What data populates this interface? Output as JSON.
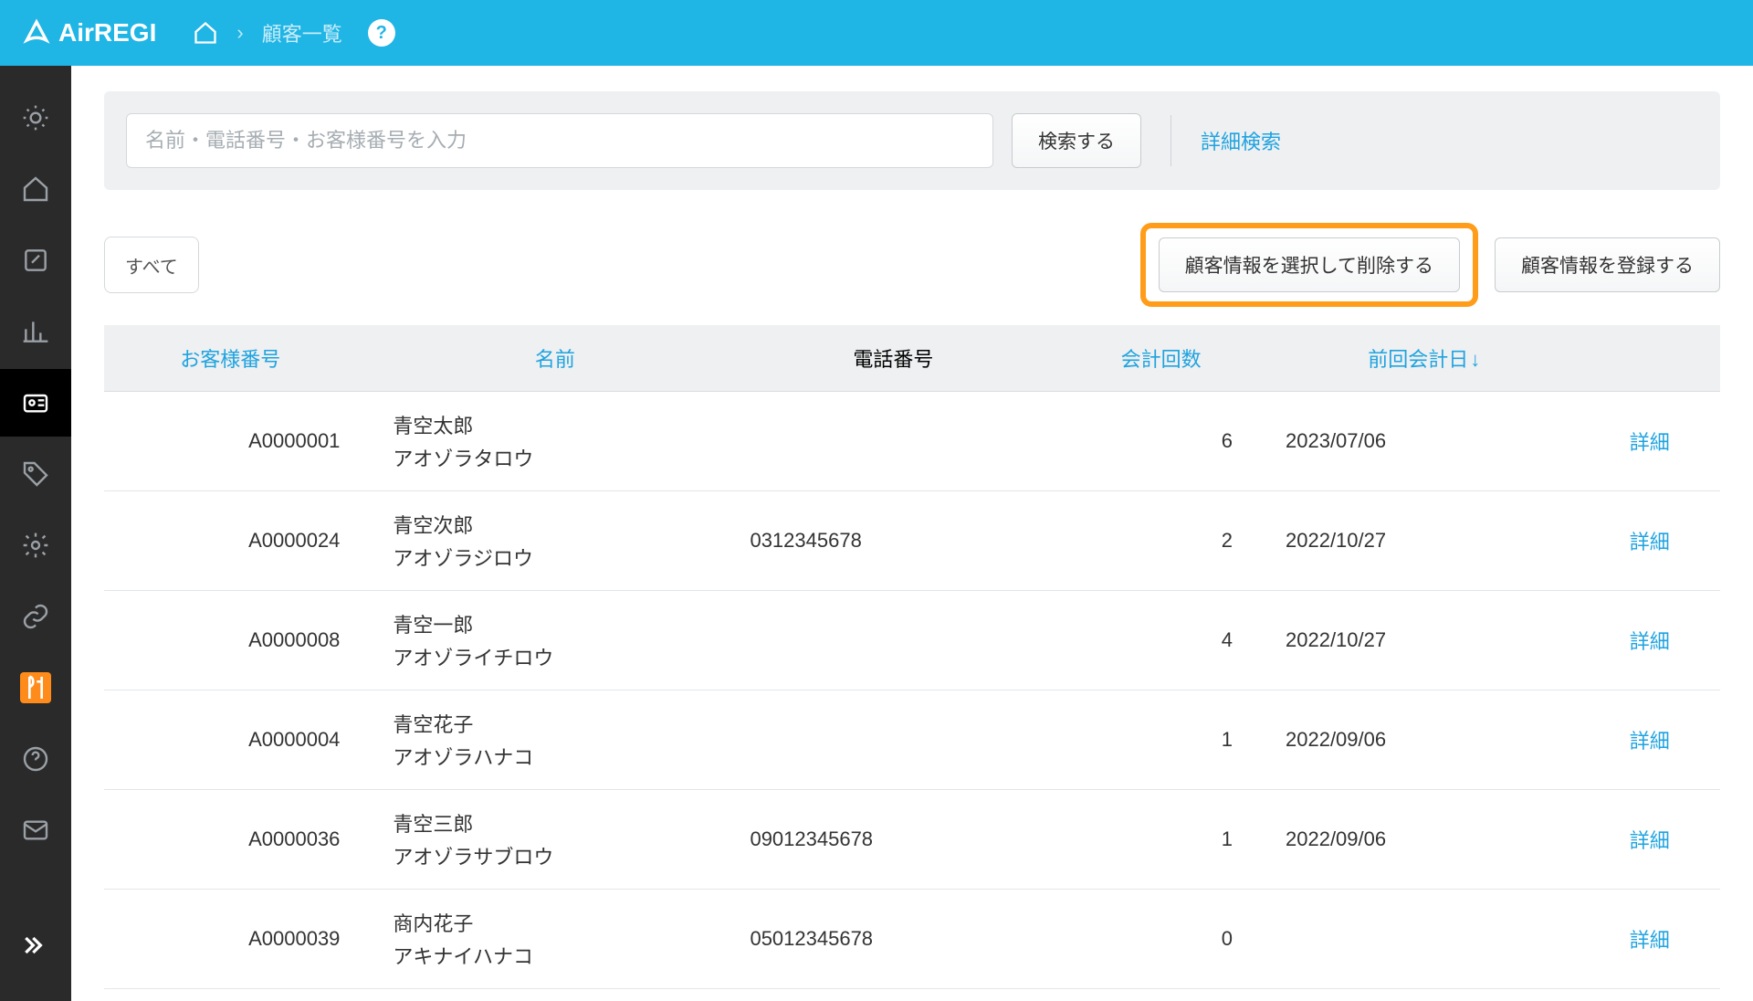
{
  "app": {
    "name": "AirREGI"
  },
  "breadcrumb": {
    "current": "顧客一覧",
    "help": "?"
  },
  "search": {
    "placeholder": "名前・電話番号・お客様番号を入力",
    "button": "検索する",
    "advanced": "詳細検索"
  },
  "toolbar": {
    "filter_all": "すべて",
    "delete_selected": "顧客情報を選択して削除する",
    "register": "顧客情報を登録する"
  },
  "table": {
    "headers": {
      "customer_no": "お客様番号",
      "name": "名前",
      "phone": "電話番号",
      "count": "会計回数",
      "last_date": "前回会計日",
      "sort_arrow": "↓"
    },
    "detail_label": "詳細",
    "rows": [
      {
        "customer_no": "A0000001",
        "name": "青空太郎",
        "kana": "アオゾラタロウ",
        "phone": "",
        "count": "6",
        "last_date": "2023/07/06"
      },
      {
        "customer_no": "A0000024",
        "name": "青空次郎",
        "kana": "アオゾラジロウ",
        "phone": "0312345678",
        "count": "2",
        "last_date": "2022/10/27"
      },
      {
        "customer_no": "A0000008",
        "name": "青空一郎",
        "kana": "アオゾライチロウ",
        "phone": "",
        "count": "4",
        "last_date": "2022/10/27"
      },
      {
        "customer_no": "A0000004",
        "name": "青空花子",
        "kana": "アオゾラハナコ",
        "phone": "",
        "count": "1",
        "last_date": "2022/09/06"
      },
      {
        "customer_no": "A0000036",
        "name": "青空三郎",
        "kana": "アオゾラサブロウ",
        "phone": "09012345678",
        "count": "1",
        "last_date": "2022/09/06"
      },
      {
        "customer_no": "A0000039",
        "name": "商内花子",
        "kana": "アキナイハナコ",
        "phone": "05012345678",
        "count": "0",
        "last_date": ""
      }
    ]
  }
}
